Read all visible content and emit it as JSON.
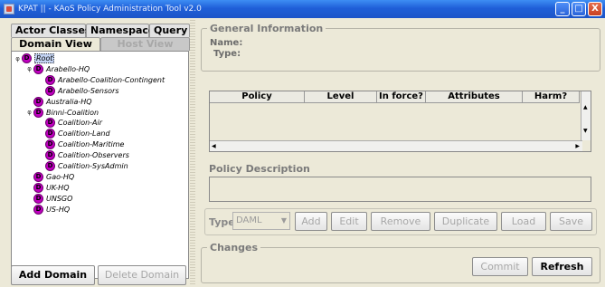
{
  "window": {
    "title": "KPAT || - KAoS Policy Administration Tool v2.0",
    "controls": {
      "minimize": "_",
      "maximize": "□",
      "close": "X"
    }
  },
  "left_panel": {
    "tabs": [
      "Actor Classes",
      "Namespaces",
      "Query"
    ],
    "subtabs": [
      "Domain View",
      "Host View"
    ],
    "tree": [
      {
        "label": "Root",
        "depth": 0,
        "expanded": true,
        "selected": true
      },
      {
        "label": "Arabello-HQ",
        "depth": 1,
        "expanded": true
      },
      {
        "label": "Arabello-Coalition-Contingent",
        "depth": 2
      },
      {
        "label": "Arabello-Sensors",
        "depth": 2
      },
      {
        "label": "Australia-HQ",
        "depth": 1
      },
      {
        "label": "Binni-Coalition",
        "depth": 1,
        "expanded": true
      },
      {
        "label": "Coalition-Air",
        "depth": 2
      },
      {
        "label": "Coalition-Land",
        "depth": 2
      },
      {
        "label": "Coalition-Maritime",
        "depth": 2
      },
      {
        "label": "Coalition-Observers",
        "depth": 2
      },
      {
        "label": "Coalition-SysAdmin",
        "depth": 2
      },
      {
        "label": "Gao-HQ",
        "depth": 1
      },
      {
        "label": "UK-HQ",
        "depth": 1
      },
      {
        "label": "UNSGO",
        "depth": 1
      },
      {
        "label": "US-HQ",
        "depth": 1
      }
    ],
    "node_glyph": "D",
    "buttons": {
      "add": "Add Domain",
      "delete": "Delete Domain"
    }
  },
  "general_info": {
    "legend": "General Information",
    "name_label": "Name:",
    "type_label": "Type:"
  },
  "policy_table": {
    "columns": [
      "Policy",
      "Level",
      "In force?",
      "Attributes",
      "Harm?"
    ]
  },
  "policy_description": {
    "label": "Policy Description"
  },
  "toolbar": {
    "type_label": "Type",
    "type_value": "DAML",
    "buttons": [
      "Add",
      "Edit",
      "Remove",
      "Duplicate",
      "Load",
      "Save"
    ]
  },
  "changes": {
    "legend": "Changes",
    "commit": "Commit",
    "refresh": "Refresh"
  },
  "colors": {
    "titlebar": "#1f5fd8",
    "node": "#c000c0",
    "background": "#ece9d8"
  }
}
